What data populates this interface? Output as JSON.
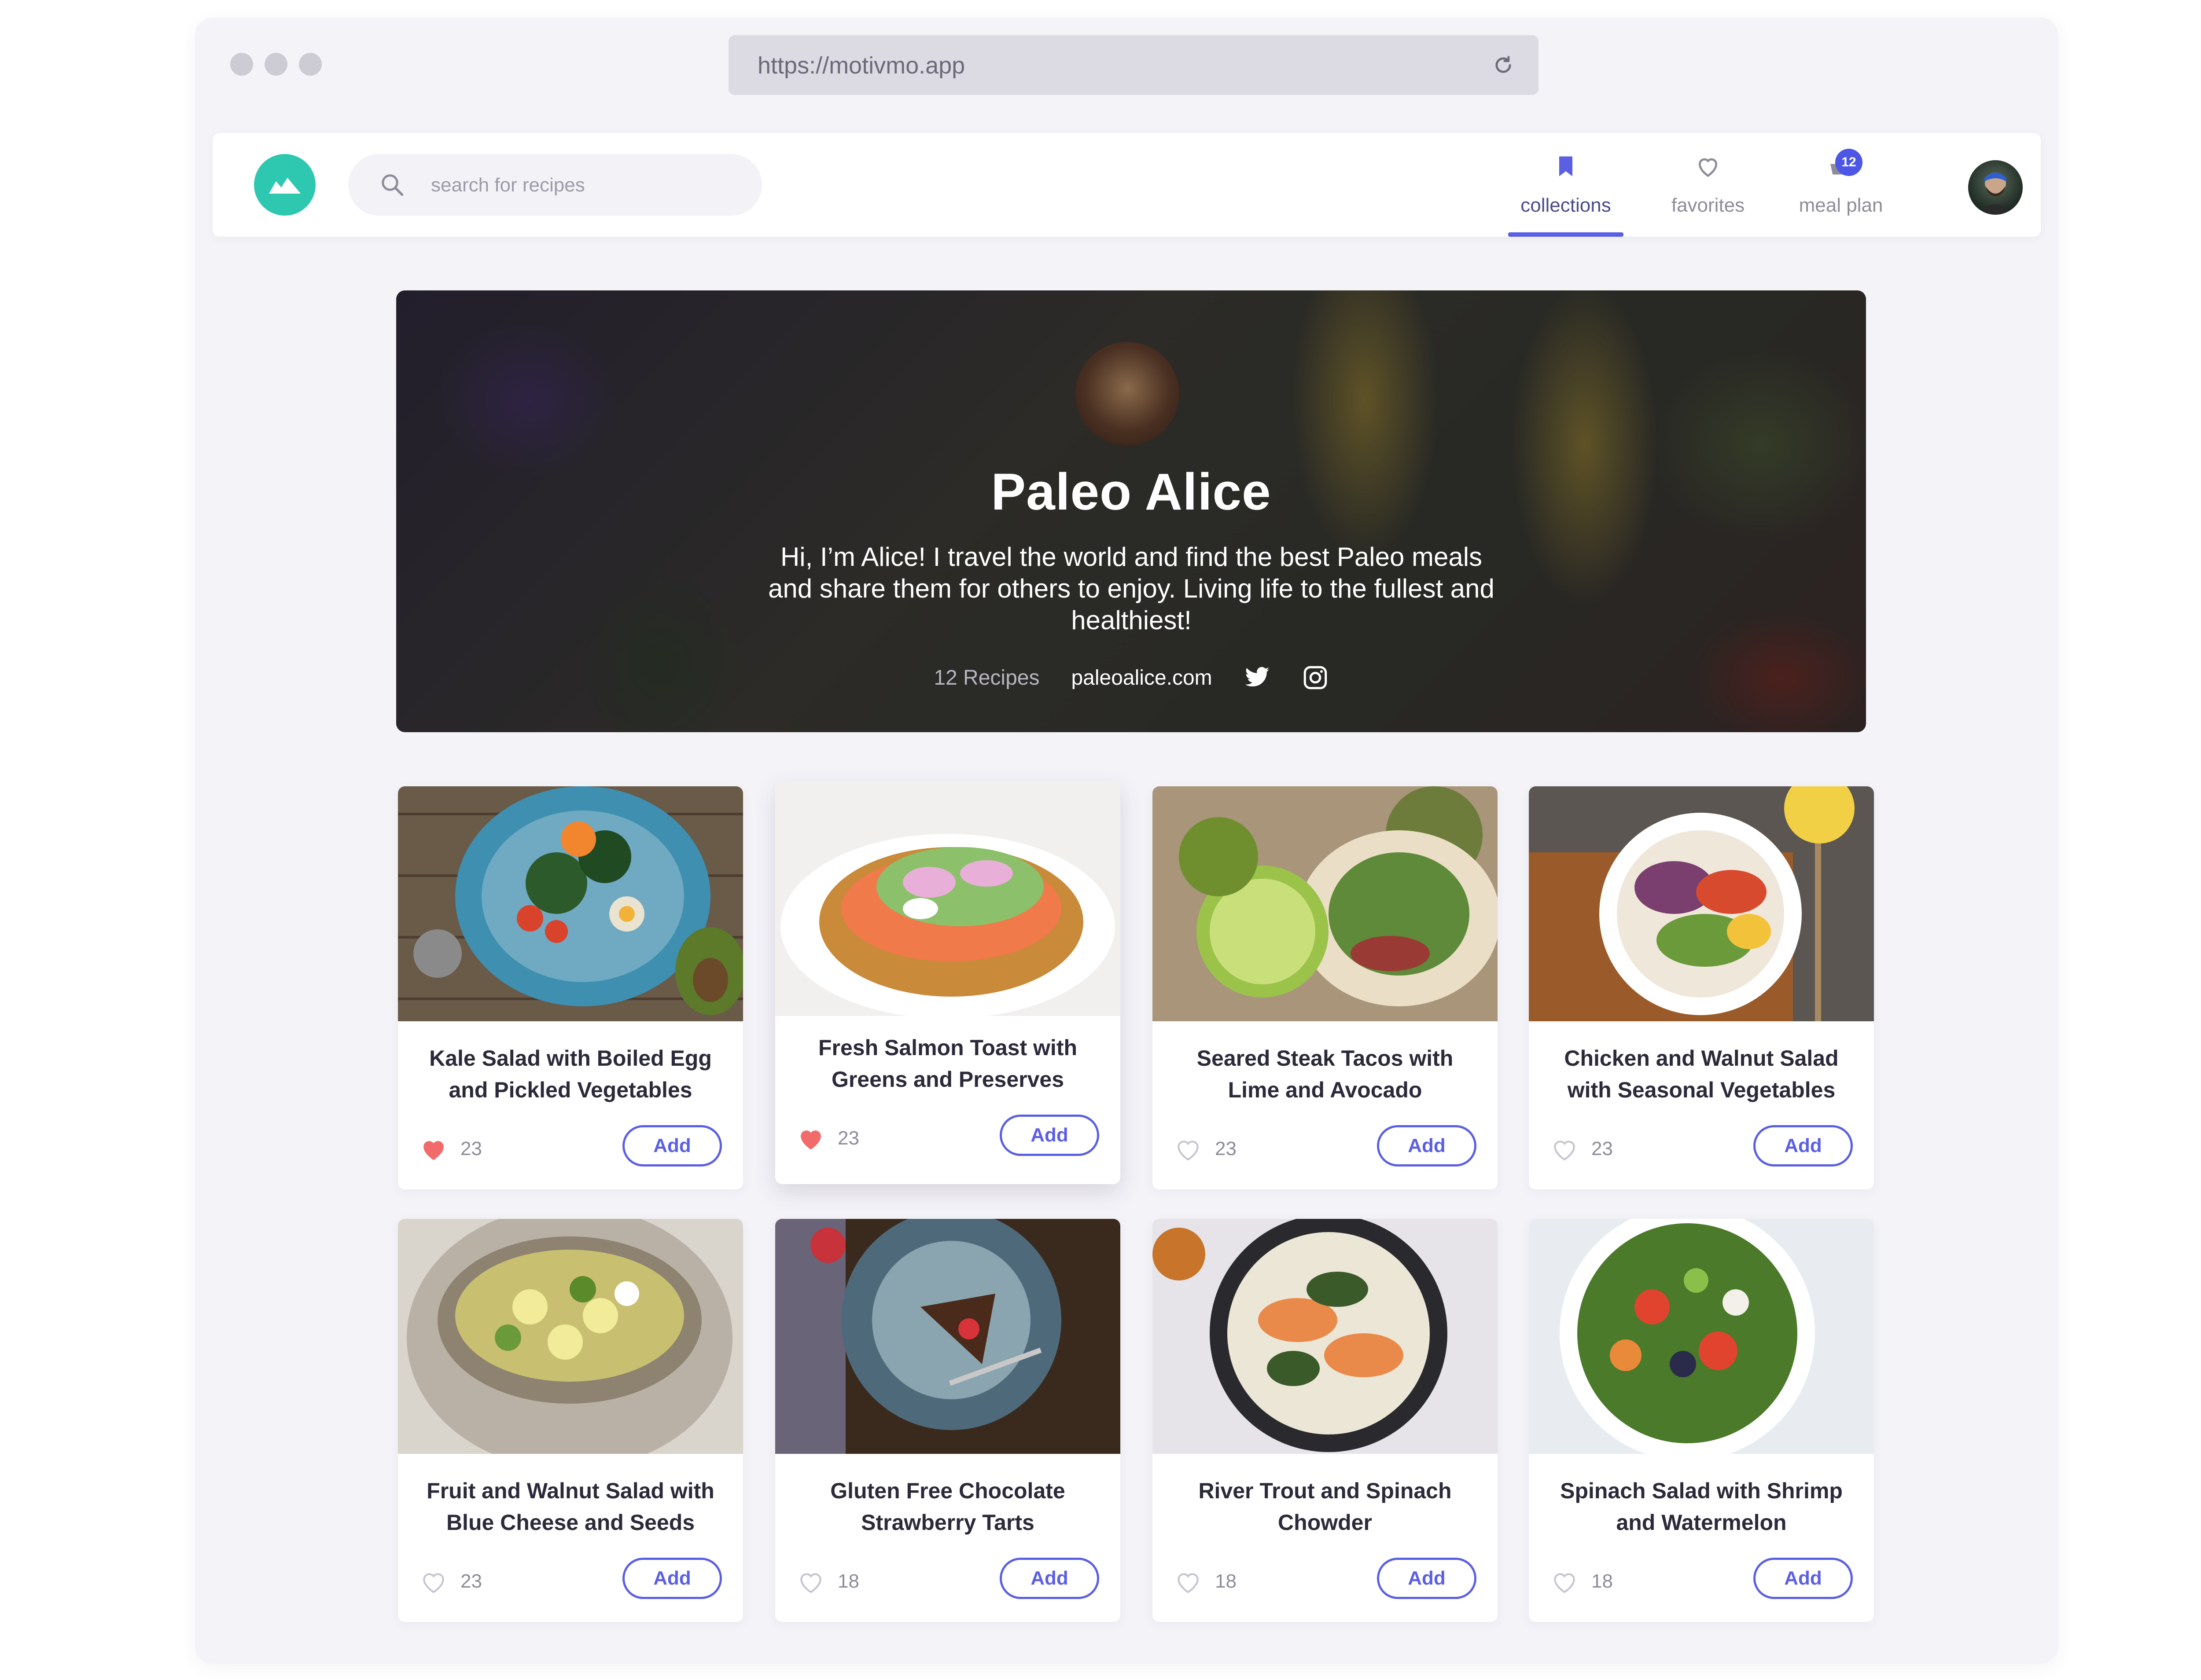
{
  "browser": {
    "url": "https://motivmo.app",
    "icons": [
      "reload-icon"
    ]
  },
  "navbar": {
    "search_placeholder": "search for recipes",
    "tabs": [
      {
        "label": "collections",
        "icon": "bookmark-icon",
        "active": true
      },
      {
        "label": "favorites",
        "icon": "heart-icon",
        "active": false
      },
      {
        "label": "meal plan",
        "icon": "basket-icon",
        "active": false,
        "badge": "12"
      }
    ]
  },
  "profile": {
    "name": "Paleo Alice",
    "bio": "Hi, I’m Alice! I travel the world and find the best Paleo meals and share them for others to enjoy. Living life to the fullest and healthiest!",
    "recipe_count": "12 Recipes",
    "website": "paleoalice.com",
    "social_icons": [
      "twitter-icon",
      "instagram-icon"
    ]
  },
  "colors": {
    "accent": "#5b5fe3",
    "logo": "#2ec8b0",
    "liked": "#f26b6b"
  },
  "recipes": [
    {
      "title": "Kale Salad with Boiled Egg and Pickled Vegetables",
      "likes": "23",
      "liked": true,
      "add_label": "Add"
    },
    {
      "title": "Fresh Salmon Toast with Greens and Preserves",
      "likes": "23",
      "liked": true,
      "add_label": "Add"
    },
    {
      "title": "Seared Steak Tacos with Lime and Avocado",
      "likes": "23",
      "liked": false,
      "add_label": "Add"
    },
    {
      "title": "Chicken and Walnut Salad with Seasonal Vegetables",
      "likes": "23",
      "liked": false,
      "add_label": "Add"
    },
    {
      "title": "Fruit and Walnut Salad with Blue Cheese and Seeds",
      "likes": "23",
      "liked": false,
      "add_label": "Add"
    },
    {
      "title": "Gluten Free Chocolate Strawberry Tarts",
      "likes": "18",
      "liked": false,
      "add_label": "Add"
    },
    {
      "title": "River Trout and Spinach Chowder",
      "likes": "18",
      "liked": false,
      "add_label": "Add"
    },
    {
      "title": "Spinach Salad with Shrimp and Watermelon",
      "likes": "18",
      "liked": false,
      "add_label": "Add"
    }
  ]
}
